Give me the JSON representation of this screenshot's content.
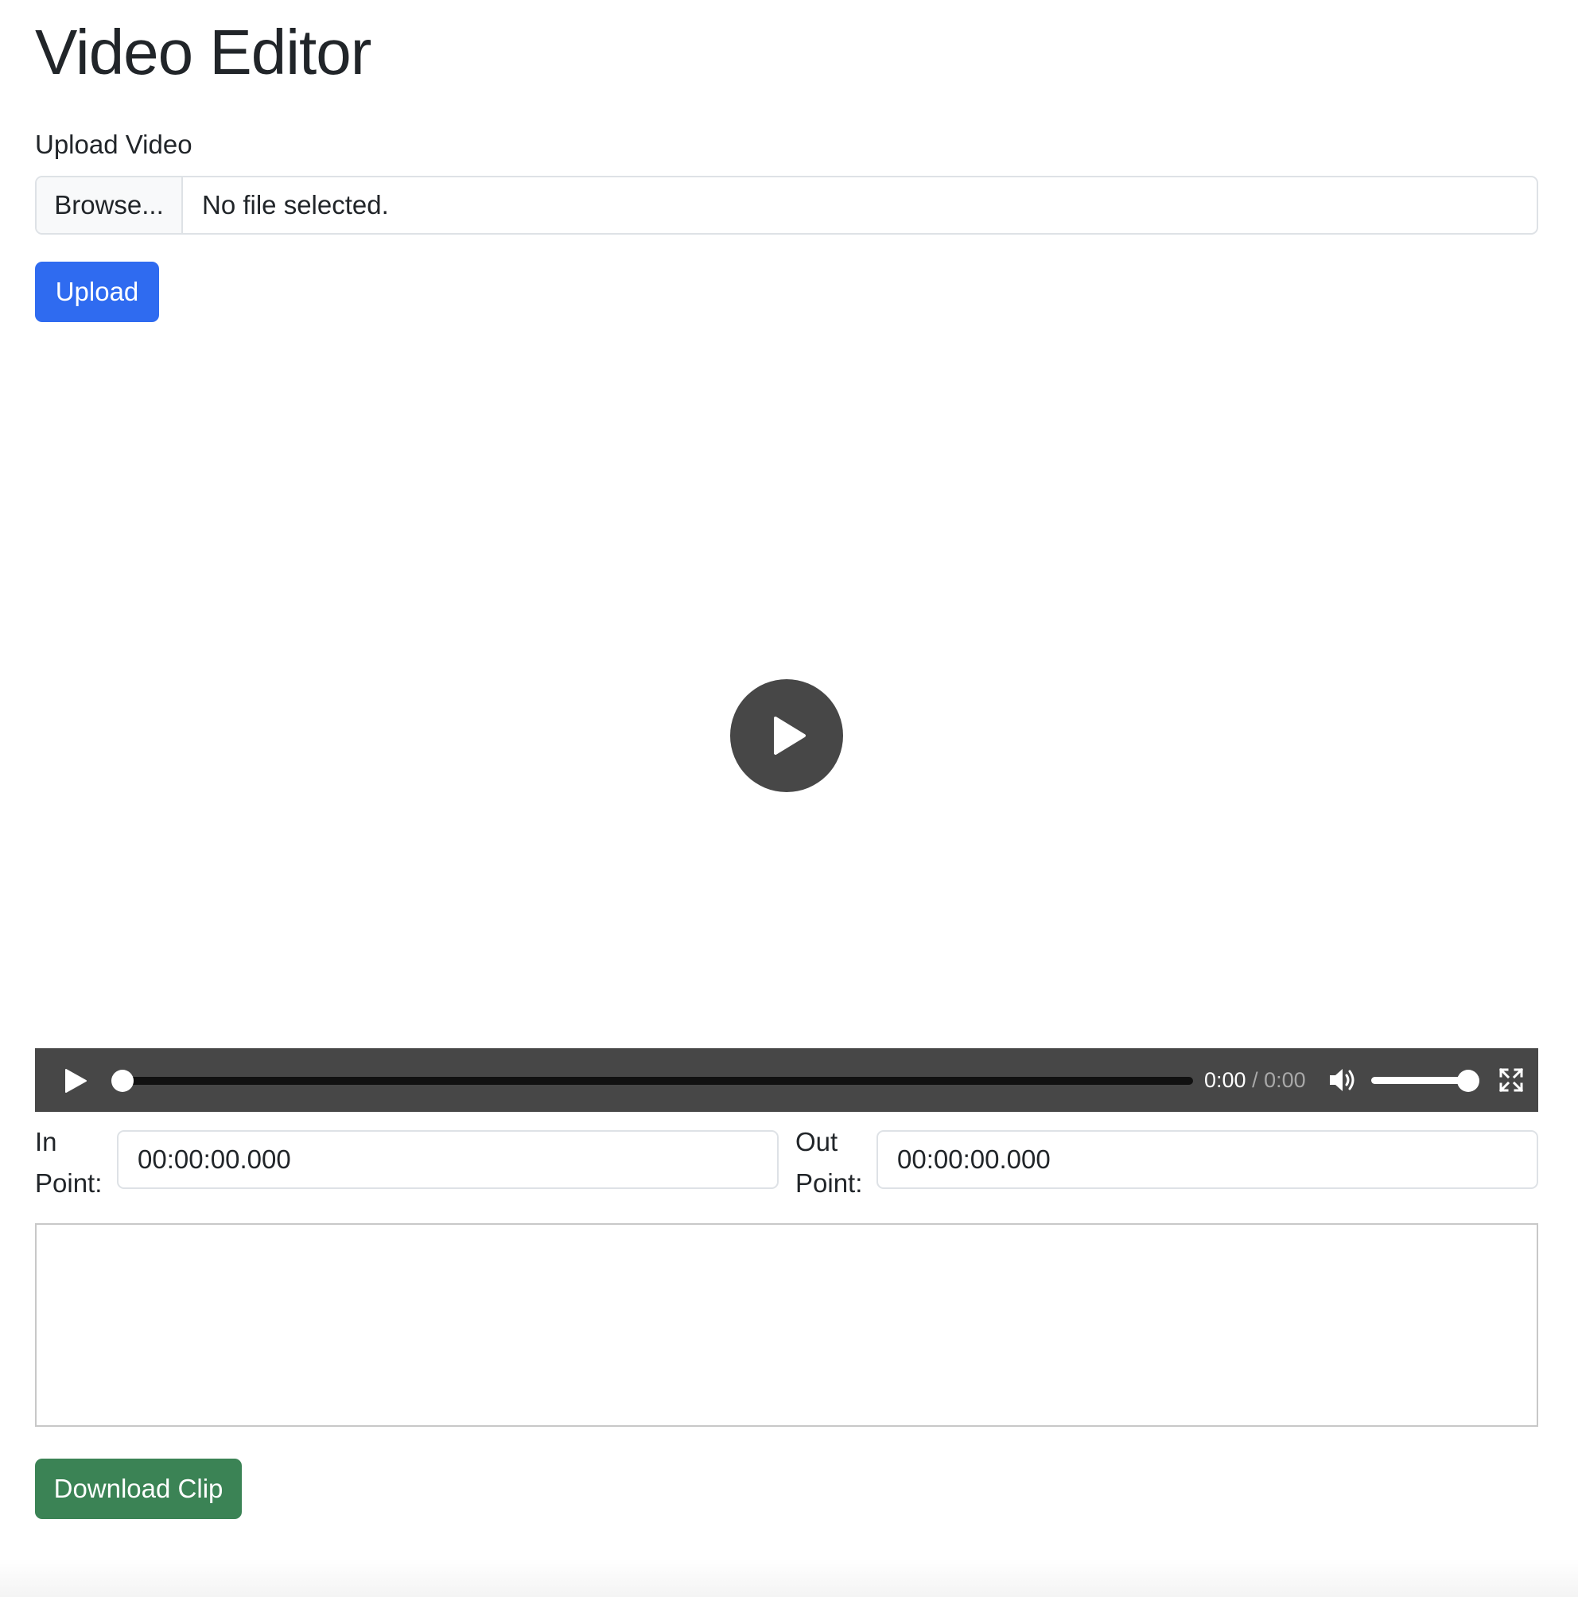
{
  "page": {
    "title": "Video Editor"
  },
  "upload": {
    "label": "Upload Video",
    "browse_label": "Browse...",
    "file_status": "No file selected.",
    "button_label": "Upload"
  },
  "player": {
    "current_time": "0:00",
    "separator": "/",
    "duration": "0:00",
    "progress": 0,
    "volume": 1.0
  },
  "points": {
    "in_label_line1": "In",
    "in_label_line2": "Point:",
    "in_value": "00:00:00.000",
    "out_label_line1": "Out",
    "out_label_line2": "Point:",
    "out_value": "00:00:00.000"
  },
  "actions": {
    "download_label": "Download Clip"
  },
  "colors": {
    "primary": "#2f6bf0",
    "success": "#3b8355",
    "player_bg": "#474747"
  },
  "icons": {
    "big_play": "play-circle-icon",
    "play": "play-icon",
    "mute": "volume-icon",
    "fullscreen": "fullscreen-icon"
  }
}
